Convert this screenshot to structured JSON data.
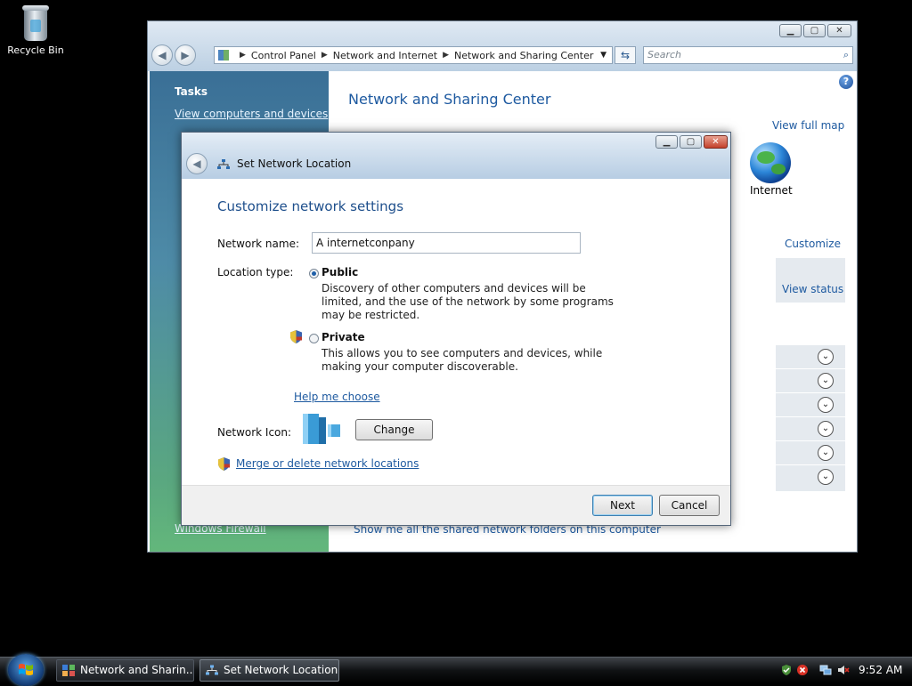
{
  "desktop": {
    "recycle_bin_label": "Recycle Bin"
  },
  "main_window": {
    "address": {
      "crumbs": [
        "Control Panel",
        "Network and Internet",
        "Network and Sharing Center"
      ]
    },
    "search_placeholder": "Search",
    "sidebar": {
      "tasks_title": "Tasks",
      "task_link_1": "View computers and devices",
      "bottom_link": "Windows Firewall"
    },
    "title": "Network and Sharing Center",
    "view_full_map": "View full map",
    "internet_label": "Internet",
    "customize": "Customize",
    "view_status": "View status",
    "shared_folders_link": "Show me all the shared network folders on this computer"
  },
  "dialog": {
    "title": "Set Network Location",
    "heading": "Customize network settings",
    "network_name_label": "Network name:",
    "network_name_value": "A internetconpany",
    "location_type_label": "Location type:",
    "public_label": "Public",
    "public_desc": "Discovery of other computers and devices will be limited, and the use of the network by some programs may be restricted.",
    "private_label": "Private",
    "private_desc": "This allows you to see computers and devices, while making your computer discoverable.",
    "help_link": "Help me choose",
    "network_icon_label": "Network Icon:",
    "change_button": "Change",
    "merge_link": "Merge or delete network locations",
    "next_button": "Next",
    "cancel_button": "Cancel",
    "selected_location": "Public"
  },
  "taskbar": {
    "items": [
      {
        "label": "Network and Sharin..."
      },
      {
        "label": "Set Network Location"
      }
    ],
    "clock": "9:52 AM"
  },
  "colors": {
    "link_blue": "#1e5aa0",
    "heading_blue": "#1e4f8c",
    "sidebar_top": "#3a6f96",
    "sidebar_bottom": "#63b77b"
  }
}
